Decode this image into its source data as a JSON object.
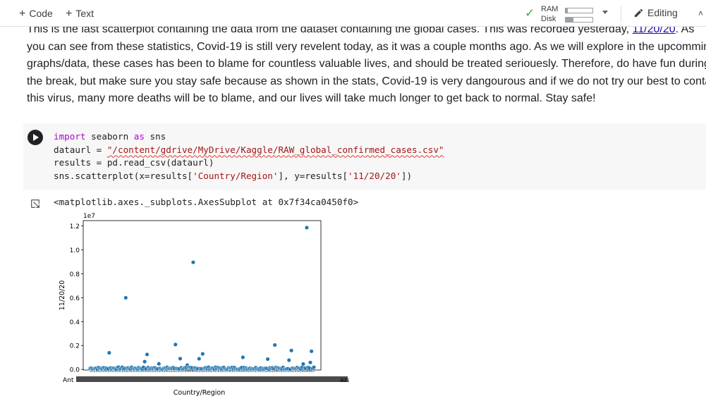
{
  "toolbar": {
    "add_code_label": "Code",
    "add_text_label": "Text",
    "ram_label": "RAM",
    "disk_label": "Disk",
    "ram_usage": 0.08,
    "disk_usage": 0.3,
    "editing_label": "Editing"
  },
  "text_cell": {
    "line1_a": "This is the last scatterplot containing the data from the dataset containing the global cases. This was recorded yesterday, ",
    "line1_link": "11/20/20",
    "line1_b": ". As",
    "line2": "you can see from these statistics, Covid-19 is still very revelent today, as it was a couple months ago. As we will explore in the upcomming",
    "line3": "graphs/data, these cases has been to blame for countless valuable lives, and should be treated seriouesly. Therefore, do have fun during",
    "line4": "the break, but make sure you stay safe because as shown in the stats, Covid-19 is very dangourous and if we do not try our best to contain",
    "line5": "this virus, many more deaths will be to blame, and our lives will take much longer to get back to normal. Stay safe!"
  },
  "code_cell": {
    "line1_kw1": "import",
    "line1_mod": " seaborn ",
    "line1_kw2": "as",
    "line1_alias": " sns",
    "line2_a": "dataurl = ",
    "line2_str": "\"/content/gdrive/MyDrive/Kaggle/RAW_global_confirmed_cases.csv\"",
    "line3": "results = pd.read_csv(dataurl)",
    "line4_a": "sns.scatterplot(x=results[",
    "line4_s1": "'Country/Region'",
    "line4_b": "], y=results[",
    "line4_s2": "'11/20/20'",
    "line4_c": "])"
  },
  "output": {
    "repr": "<matplotlib.axes._subplots.AxesSubplot at 0x7f34ca0450f0>"
  },
  "chart_data": {
    "type": "scatter",
    "xlabel": "Country/Region",
    "ylabel": "11/20/20",
    "offset_label": "1e7",
    "ylim": [
      -50000,
      12450000
    ],
    "yticks": [
      "0.0",
      "0.2",
      "0.4",
      "0.6",
      "0.8",
      "1.0",
      "1.2"
    ],
    "first_tick_label": "Ant",
    "last_tick_label": "aza",
    "point_color": "#1f77b4",
    "x_count": 190,
    "highlighted_points": [
      {
        "x": 16,
        "y": 1390000
      },
      {
        "x": 30,
        "y": 5990000
      },
      {
        "x": 46,
        "y": 650000
      },
      {
        "x": 48,
        "y": 1250000
      },
      {
        "x": 58,
        "y": 470000
      },
      {
        "x": 72,
        "y": 2080000
      },
      {
        "x": 76,
        "y": 900000
      },
      {
        "x": 82,
        "y": 360000
      },
      {
        "x": 87,
        "y": 8960000
      },
      {
        "x": 92,
        "y": 890000
      },
      {
        "x": 95,
        "y": 1300000
      },
      {
        "x": 129,
        "y": 1010000
      },
      {
        "x": 150,
        "y": 860000
      },
      {
        "x": 156,
        "y": 2040000
      },
      {
        "x": 170,
        "y": 1580000
      },
      {
        "x": 168,
        "y": 770000
      },
      {
        "x": 180,
        "y": 450000
      },
      {
        "x": 183,
        "y": 11860000
      },
      {
        "x": 187,
        "y": 1520000
      },
      {
        "x": 186,
        "y": 580000
      }
    ]
  }
}
